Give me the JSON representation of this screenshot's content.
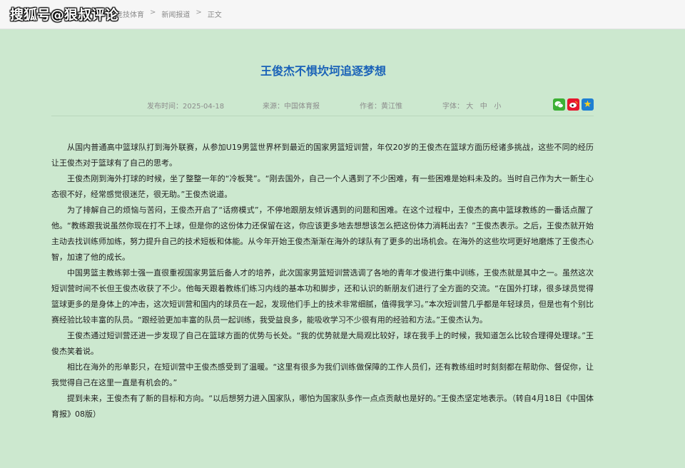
{
  "watermark": "搜狐号@狠叔评论",
  "breadcrumb": {
    "items": [
      "竞技体育",
      "新闻报道",
      "正文"
    ],
    "separator": ">"
  },
  "article": {
    "title": "王俊杰不惧坎坷追逐梦想",
    "meta": {
      "date": "发布时间：2025-04-18",
      "source": "来源：中国体育报",
      "author": "作者：黄江惟",
      "font_label": "字体：",
      "font_large": "大",
      "font_medium": "中",
      "font_small": "小"
    },
    "share_icons": [
      "wechat-icon",
      "weibo-icon",
      "favorite-icon"
    ],
    "paragraphs": [
      "从国内普通高中篮球队打到海外联赛，从参加U19男篮世界杯到最近的国家男篮短训营，年仅20岁的王俊杰在篮球方面历经诸多挑战，这些不同的经历让王俊杰对于篮球有了自己的思考。",
      "王俊杰刚到海外打球的时候，坐了整整一年的“冷板凳”。“刚去国外，自己一个人遇到了不少困难，有一些困难是始料未及的。当时自己作为大一新生心态很不好，经常感觉很迷茫，很无助。”王俊杰说道。",
      "为了排解自己的烦恼与苦闷，王俊杰开启了“话痨模式”，不停地跟朋友倾诉遇到的问题和困难。在这个过程中，王俊杰的高中篮球教练的一番话点醒了他。“教练跟我说虽然你现在打不上球，但是你的这份体力还保留在这，你应该更多地去想想该怎么把这份体力消耗出去？”王俊杰表示。之后，王俊杰就开始主动去找训练师加练，努力提升自己的技术短板和体能。从今年开始王俊杰渐渐在海外的球队有了更多的出场机会。在海外的这些坎坷更好地磨炼了王俊杰心智，加速了他的成长。",
      "中国男篮主教练郭士强一直很重视国家男篮后备人才的培养，此次国家男篮短训营选调了各地的青年才俊进行集中训练，王俊杰就是其中之一。虽然这次短训营时间不长但王俊杰收获了不少。他每天跟着教练们练习内线的基本功和脚步，还和认识的新朋友们进行了全方面的交流。“在国外打球，很多球员觉得篮球更多的是身体上的冲击，这次短训营和国内的球员在一起，发现他们手上的技术非常细腻，值得我学习。”本次短训营几乎都是年轻球员，但是也有个别比赛经验比较丰富的队员。“跟经验更加丰富的队员一起训练，我受益良多，能吸收学习不少很有用的经验和方法。”王俊杰认为。",
      "王俊杰通过短训营还进一步发现了自己在篮球方面的优势与长处。“我的优势就是大局观比较好，球在我手上的时候，我知道怎么比较合理得处理球。”王俊杰笑着说。",
      "相比在海外的形单影只，在短训营中王俊杰感受到了温暖。“这里有很多为我们训练做保障的工作人员们，还有教练组时时刻刻都在帮助你、督促你，让我觉得自己在这里一直是有机会的。”",
      "提到未来，王俊杰有了新的目标和方向。“以后想努力进入国家队，哪怕为国家队多作一点点贡献也是好的。”王俊杰坚定地表示。（转自4月18日《中国体育报》08版）"
    ]
  }
}
